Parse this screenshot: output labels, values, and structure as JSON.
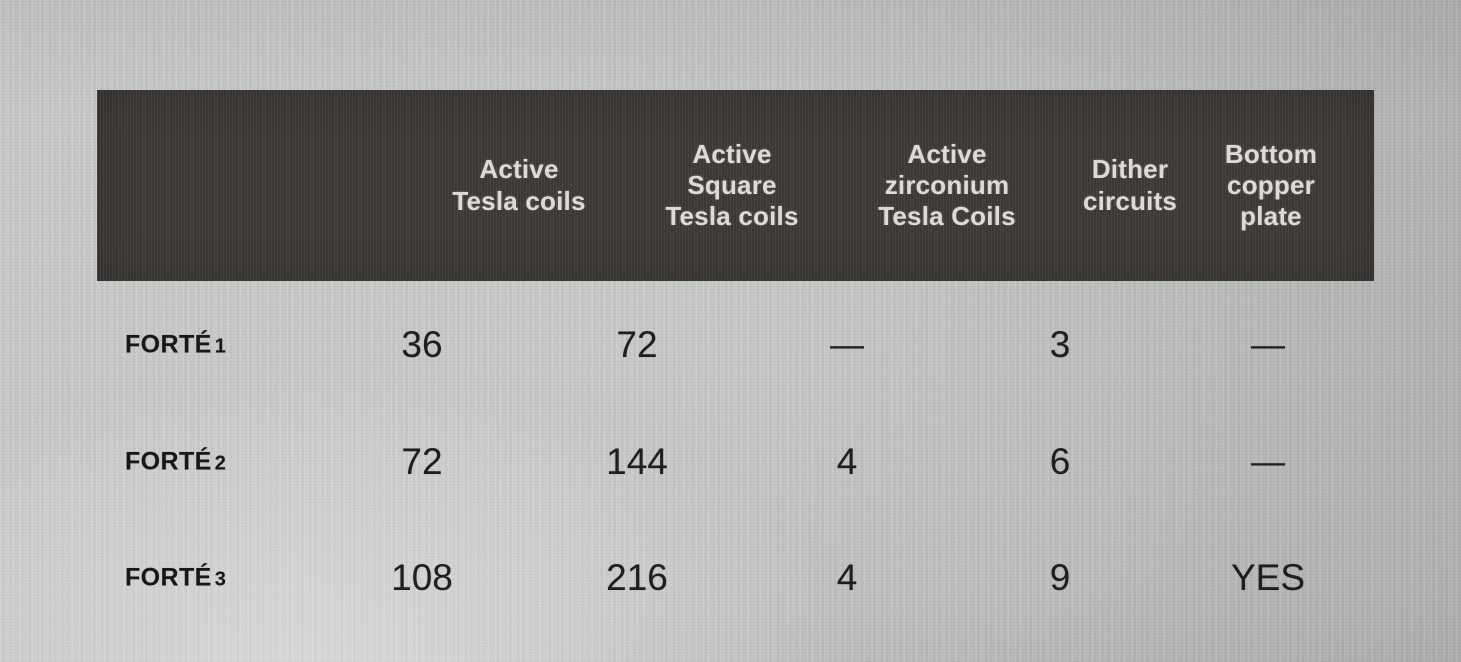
{
  "table": {
    "columns": [
      {
        "id": "row-label",
        "lines": []
      },
      {
        "id": "active-tesla-coils",
        "lines": [
          "Active",
          "Tesla coils"
        ]
      },
      {
        "id": "active-square-tesla-coils",
        "lines": [
          "Active",
          "Square",
          "Tesla coils"
        ]
      },
      {
        "id": "active-zirconium-tesla-coils",
        "lines": [
          "Active",
          "zirconium",
          "Tesla Coils"
        ]
      },
      {
        "id": "dither-circuits",
        "lines": [
          "Dither",
          "circuits"
        ]
      },
      {
        "id": "bottom-copper-plate",
        "lines": [
          "Bottom",
          "copper",
          "plate"
        ]
      }
    ],
    "rows": [
      {
        "label_text": "FORTÉ",
        "label_number": "1",
        "values": [
          "36",
          "72",
          "—",
          "3",
          "—"
        ]
      },
      {
        "label_text": "FORTÉ",
        "label_number": "2",
        "values": [
          "72",
          "144",
          "4",
          "6",
          "—"
        ]
      },
      {
        "label_text": "FORTÉ",
        "label_number": "3",
        "values": [
          "108",
          "216",
          "4",
          "9",
          "YES"
        ]
      }
    ]
  },
  "colors": {
    "header_background": "#3e3b38",
    "header_text": "#dedbd6",
    "body_text": "#1e1f21",
    "screen_background": "#c2c4c3"
  }
}
